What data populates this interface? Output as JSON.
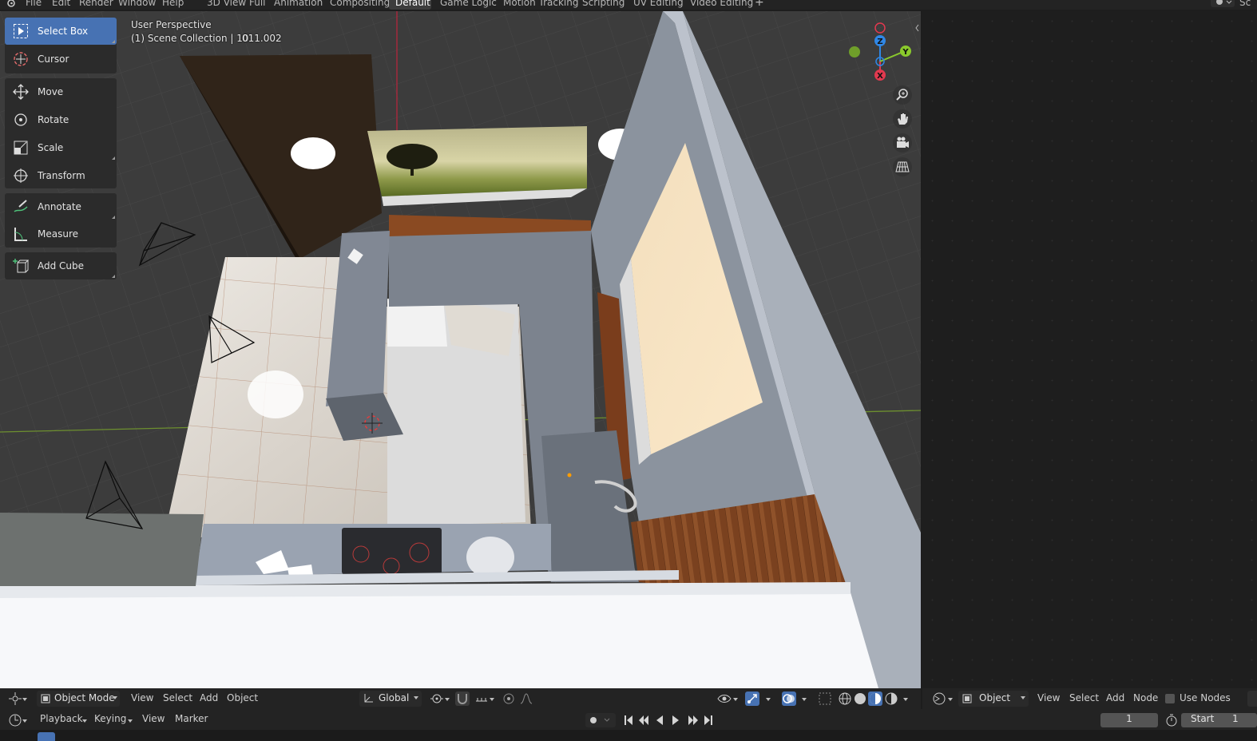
{
  "menu": {
    "items": [
      "File",
      "Edit",
      "Render",
      "Window",
      "Help"
    ],
    "workspaces": [
      "3D View Full",
      "Animation",
      "Compositing",
      "Default",
      "Game Logic",
      "Motion Tracking",
      "Scripting",
      "UV Editing",
      "Video Editing"
    ],
    "active_workspace": "Default",
    "add_tab": "+",
    "right_cut_label": "Sc"
  },
  "toolbar": {
    "tools": [
      {
        "label": "Select Box",
        "icon": "select-box-icon",
        "active": true
      },
      {
        "label": "Cursor",
        "icon": "cursor-icon"
      },
      {
        "label": "Move",
        "icon": "move-icon"
      },
      {
        "label": "Rotate",
        "icon": "rotate-icon"
      },
      {
        "label": "Scale",
        "icon": "scale-icon"
      },
      {
        "label": "Transform",
        "icon": "transform-icon"
      },
      {
        "label": "Annotate",
        "icon": "annotate-icon"
      },
      {
        "label": "Measure",
        "icon": "measure-icon"
      },
      {
        "label": "Add Cube",
        "icon": "add-cube-icon"
      }
    ]
  },
  "viewport": {
    "perspective": "User Perspective",
    "collection": "(1) Scene Collection | 10",
    "object": "011.002",
    "gizmo": {
      "z": "Z",
      "y": "Y",
      "x": "X"
    }
  },
  "viewport_header": {
    "editor_icon": "3d-viewport-icon",
    "mode": "Object Mode",
    "menus": [
      "View",
      "Select",
      "Add",
      "Object"
    ],
    "orientation": "Global"
  },
  "node_header": {
    "editor_icon": "node-editor-icon",
    "object_type": "Object",
    "menus": [
      "View",
      "Select",
      "Add",
      "Node"
    ],
    "use_nodes_label": "Use Nodes",
    "use_nodes": false
  },
  "timeline": {
    "menus": [
      "Playback",
      "Keying",
      "View",
      "Marker"
    ],
    "current_frame": "1",
    "start_label": "Start",
    "start_value": "1"
  },
  "colors": {
    "accent": "#4772b3",
    "axis_x": "#e2394f",
    "axis_y": "#8ac92c",
    "axis_z": "#2f87e6"
  }
}
